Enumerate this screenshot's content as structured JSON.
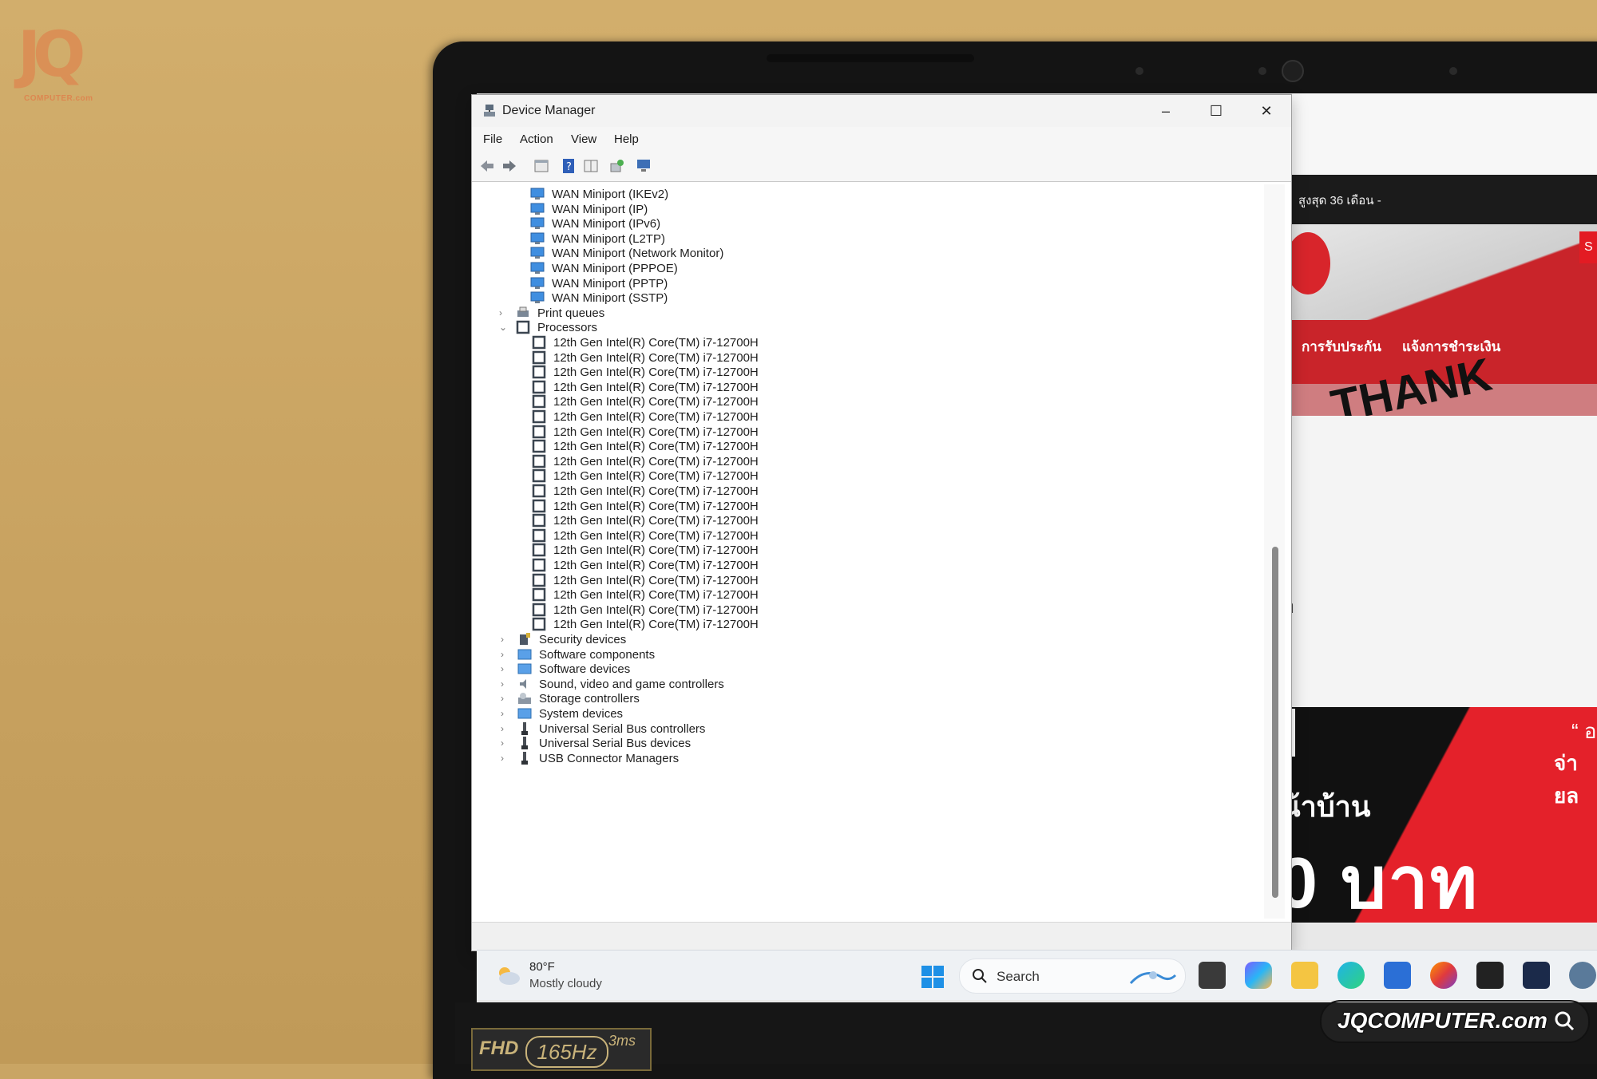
{
  "watermark": {
    "logo": "JQ",
    "site": "COMPUTER.com"
  },
  "window": {
    "title": "Device Manager",
    "controls": {
      "minimize": "–",
      "maximize": "☐",
      "close": "✕"
    },
    "menu": [
      "File",
      "Action",
      "View",
      "Help"
    ]
  },
  "tree": {
    "network_adapters": [
      "WAN Miniport (IKEv2)",
      "WAN Miniport (IP)",
      "WAN Miniport (IPv6)",
      "WAN Miniport (L2TP)",
      "WAN Miniport (Network Monitor)",
      "WAN Miniport (PPPOE)",
      "WAN Miniport (PPTP)",
      "WAN Miniport (SSTP)"
    ],
    "print_queues": "Print queues",
    "processors": "Processors",
    "processor_name": "12th Gen Intel(R) Core(TM) i7-12700H",
    "processor_count": 20,
    "categories_after": [
      "Security devices",
      "Software components",
      "Software devices",
      "Sound, video and game controllers",
      "Storage controllers",
      "System devices",
      "Universal Serial Bus controllers",
      "Universal Serial Bus devices",
      "USB Connector Managers"
    ]
  },
  "taskbar": {
    "weather_temp": "80°F",
    "weather_condition": "Mostly cloudy",
    "search_placeholder": "Search"
  },
  "background_browser": {
    "promo_text": "สูงสุด 36 เดือน -",
    "link_1": "การรับประกัน",
    "link_2": "แจ้งการชำระเงิน",
    "banner_word": "THANK",
    "banner2_quote": "“ อ",
    "banner2_pay": "จ่ายล",
    "banner2_home": "น้าบ้าน",
    "banner2_price": "0 บาท",
    "glyph": "ท",
    "tag": "S"
  },
  "bezel": {
    "sticker_resolution": "FHD",
    "sticker_refresh": "165Hz",
    "sticker_response": "3ms"
  },
  "brand_watermark": "JQCOMPUTER.com"
}
